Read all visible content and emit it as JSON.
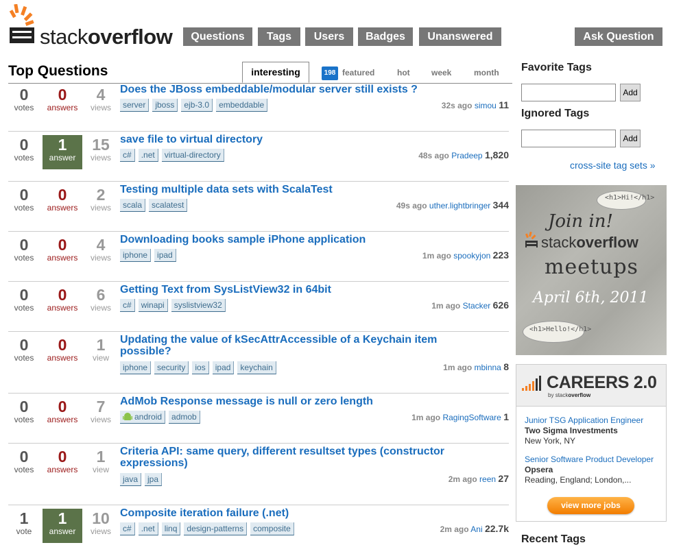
{
  "logo": {
    "prefix": "stack",
    "suffix": "overflow"
  },
  "nav": [
    "Questions",
    "Tags",
    "Users",
    "Badges",
    "Unanswered"
  ],
  "ask_label": "Ask Question",
  "page_title": "Top Questions",
  "tabs": {
    "active": "interesting",
    "featured_count": "198",
    "featured": "featured",
    "hot": "hot",
    "week": "week",
    "month": "month"
  },
  "questions": [
    {
      "votes": "0",
      "votes_label": "votes",
      "answers": "0",
      "answers_label": "answers",
      "answered": false,
      "views": "4",
      "views_label": "views",
      "title": "Does the JBoss embeddable/modular server still exists ?",
      "tags": [
        "server",
        "jboss",
        "ejb-3.0",
        "embeddable"
      ],
      "time": "32s ago",
      "user": "simou",
      "rep": "11"
    },
    {
      "votes": "0",
      "votes_label": "votes",
      "answers": "1",
      "answers_label": "answer",
      "answered": true,
      "views": "15",
      "views_label": "views",
      "title": "save file to virtual directory",
      "tags": [
        "c#",
        ".net",
        "virtual-directory"
      ],
      "time": "48s ago",
      "user": "Pradeep",
      "rep": "1,820"
    },
    {
      "votes": "0",
      "votes_label": "votes",
      "answers": "0",
      "answers_label": "answers",
      "answered": false,
      "views": "2",
      "views_label": "views",
      "title": "Testing multiple data sets with ScalaTest",
      "tags": [
        "scala",
        "scalatest"
      ],
      "time": "49s ago",
      "user": "uther.lightbringer",
      "rep": "344"
    },
    {
      "votes": "0",
      "votes_label": "votes",
      "answers": "0",
      "answers_label": "answers",
      "answered": false,
      "views": "4",
      "views_label": "views",
      "title": "Downloading books sample iPhone application",
      "tags": [
        "iphone",
        "ipad"
      ],
      "time": "1m ago",
      "user": "spookyjon",
      "rep": "223"
    },
    {
      "votes": "0",
      "votes_label": "votes",
      "answers": "0",
      "answers_label": "answers",
      "answered": false,
      "views": "6",
      "views_label": "views",
      "title": "Getting Text from SysListView32 in 64bit",
      "tags": [
        "c#",
        "winapi",
        "syslistview32"
      ],
      "time": "1m ago",
      "user": "Stacker",
      "rep": "626"
    },
    {
      "votes": "0",
      "votes_label": "votes",
      "answers": "0",
      "answers_label": "answers",
      "answered": false,
      "views": "1",
      "views_label": "view",
      "title": "Updating the value of kSecAttrAccessible of a Keychain item possible?",
      "tags": [
        "iphone",
        "security",
        "ios",
        "ipad",
        "keychain"
      ],
      "time": "1m ago",
      "user": "mbinna",
      "rep": "8"
    },
    {
      "votes": "0",
      "votes_label": "votes",
      "answers": "0",
      "answers_label": "answers",
      "answered": false,
      "views": "7",
      "views_label": "views",
      "title": "AdMob Response message is null or zero length",
      "tags": [
        "android",
        "admob"
      ],
      "time": "1m ago",
      "user": "RagingSoftware",
      "rep": "1"
    },
    {
      "votes": "0",
      "votes_label": "votes",
      "answers": "0",
      "answers_label": "answers",
      "answered": false,
      "views": "1",
      "views_label": "view",
      "title": "Criteria API: same query, different resultset types (constructor expressions)",
      "tags": [
        "java",
        "jpa"
      ],
      "time": "2m ago",
      "user": "reen",
      "rep": "27"
    },
    {
      "votes": "1",
      "votes_label": "vote",
      "answers": "1",
      "answers_label": "answer",
      "answered": true,
      "views": "10",
      "views_label": "views",
      "title": "Composite iteration failure (.net)",
      "tags": [
        "c#",
        ".net",
        "linq",
        "design-patterns",
        "composite"
      ],
      "time": "2m ago",
      "user": "Ani",
      "rep": "22.7k"
    }
  ],
  "sidebar": {
    "favorite_tags": "Favorite Tags",
    "ignored_tags": "Ignored Tags",
    "add_label": "Add",
    "cross_site": "cross-site tag sets »",
    "meetup": {
      "bubble1": "<h1>Hi!</h1>",
      "join": "Join in!",
      "logo_prefix": "stack",
      "logo_suffix": "overflow",
      "meetups": "meetups",
      "date": "April 6th, 2011",
      "bubble2": "<h1>Hello!</h1>"
    },
    "careers": {
      "title": "CAREERS 2.0",
      "by": "by",
      "by_stack": "stack",
      "by_overflow": "overflow",
      "jobs": [
        {
          "title": "Junior TSG Application Engineer",
          "company": "Two Sigma Investments",
          "location": "New York, NY"
        },
        {
          "title": "Senior Software Product Developer",
          "company": "Opsera",
          "location": "Reading, England; London,..."
        }
      ],
      "view_more": "view more jobs"
    },
    "recent_tags": "Recent Tags"
  },
  "colors": {
    "link": "#1a6dbd",
    "nav_bg": "#777777",
    "answered_bg": "#5b7349",
    "answers_red": "#9a1818",
    "tag_bg": "#e0eaf1",
    "accent_orange": "#f48024"
  }
}
